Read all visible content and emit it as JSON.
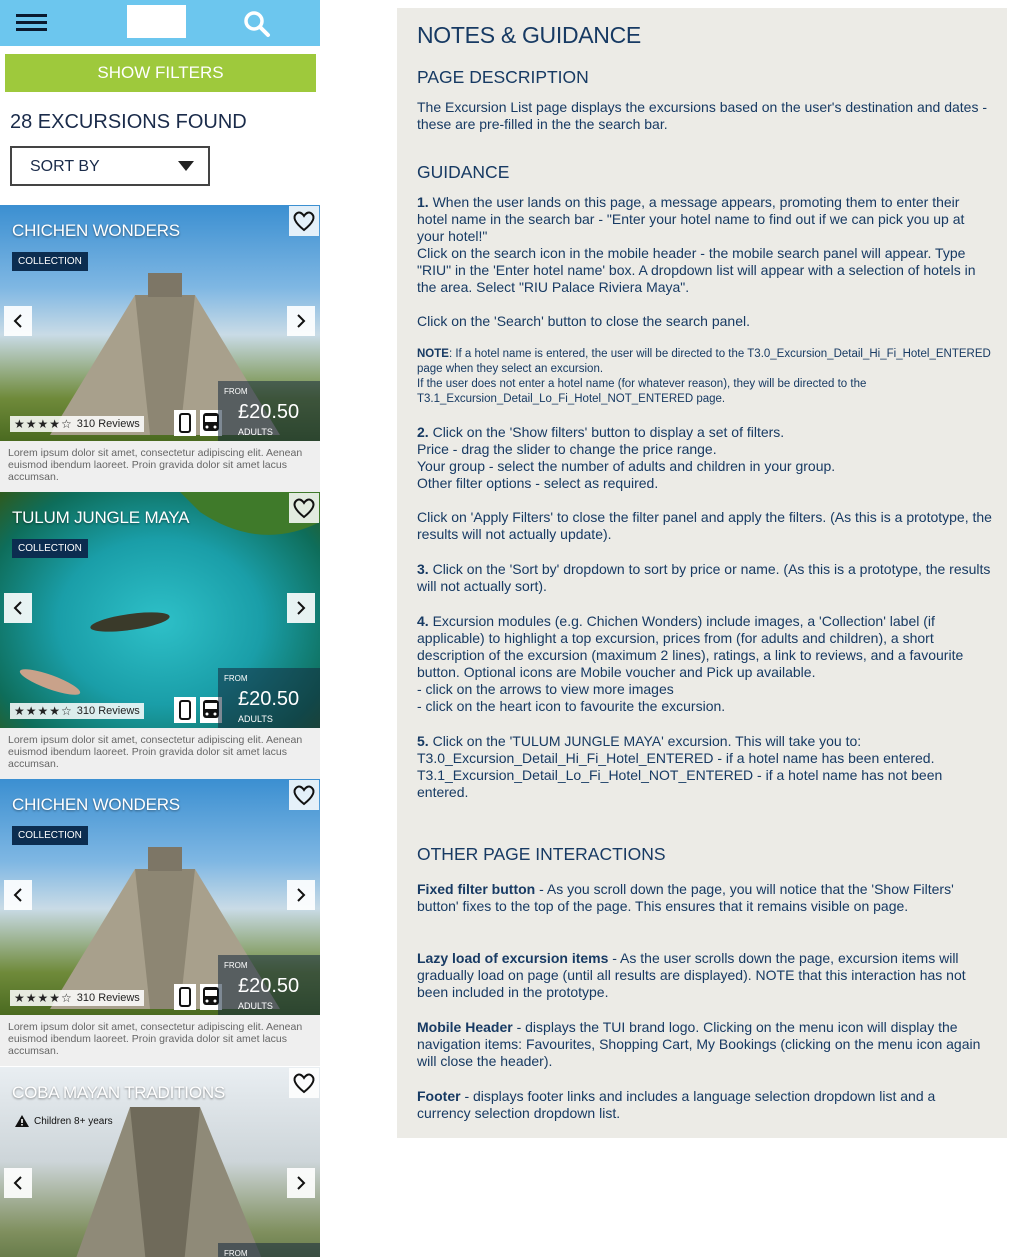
{
  "mobile": {
    "filters_label": "SHOW FILTERS",
    "results_count_text": "28 EXCURSIONS FOUND",
    "sort_label": "SORT BY",
    "cards": [
      {
        "title": "CHICHEN WONDERS",
        "badge": "COLLECTION",
        "rating_text": "310 Reviews",
        "from": "FROM",
        "price": "£20.50",
        "unit": "ADULTS",
        "description": "Lorem ipsum dolor sit amet, consectetur adipiscing elit. Aenean euismod ibendum laoreet. Proin gravida dolor sit amet lacus accumsan."
      },
      {
        "title": "TULUM JUNGLE MAYA",
        "badge": "COLLECTION",
        "rating_text": "310 Reviews",
        "from": "FROM",
        "price": "£20.50",
        "unit": "ADULTS",
        "description": "Lorem ipsum dolor sit amet, consectetur adipiscing elit. Aenean euismod ibendum laoreet. Proin gravida dolor sit amet lacus accumsan."
      },
      {
        "title": "CHICHEN WONDERS",
        "badge": "COLLECTION",
        "rating_text": "310 Reviews",
        "from": "FROM",
        "price": "£20.50",
        "unit": "ADULTS",
        "description": "Lorem ipsum dolor sit amet, consectetur adipiscing elit. Aenean euismod ibendum laoreet. Proin gravida dolor sit amet lacus accumsan."
      },
      {
        "title": "COBA MAYAN TRADITIONS",
        "warning": "Children 8+ years",
        "from": "FROM"
      }
    ],
    "stars": "★★★★☆",
    "colors": {
      "header": "#6cc6ee",
      "filters": "#9ec93c",
      "badge": "#0c2d50"
    }
  },
  "notes": {
    "title": "NOTES & GUIDANCE",
    "page_description_heading": "PAGE DESCRIPTION",
    "page_description": "The Excursion List page displays the excursions based on the user's destination and dates - these are pre-filled in the the search bar.",
    "guidance_heading": "GUIDANCE",
    "g1_num": "1.",
    "g1_text": "When the user lands on this page, a message appears, promoting them to enter their hotel name in the search bar - \"Enter your hotel name to find out if we can pick you up at your hotel!\"",
    "g1_text2": "Click on the search icon in the mobile header - the mobile search panel will appear. Type \"RIU\" in the 'Enter hotel name' box. A dropdown list will appear with a selection of hotels in the area. Select \"RIU Palace Riviera Maya\".",
    "g1_text3": "Click on the 'Search' button to close the search panel.",
    "note_label": "NOTE",
    "note_text": ": If a hotel name is entered, the user will be directed to the T3.0_Excursion_Detail_Hi_Fi_Hotel_ENTERED page when they select an excursion.",
    "note_text2": "If the user does not enter a hotel name (for whatever reason), they will be directed to the T3.1_Excursion_Detail_Lo_Fi_Hotel_NOT_ENTERED page.",
    "g2_num": "2.",
    "g2_text": "Click on the 'Show filters' button to display a set of filters.",
    "g2_line2": "Price - drag the slider to change the price range.",
    "g2_line3": "Your group - select the number of adults and children in your group.",
    "g2_line4": "Other filter options - select as required.",
    "g2_text5": "Click on 'Apply Filters' to close the filter panel and apply the filters. (As this is a prototype, the results will not actually update).",
    "g3_num": "3.",
    "g3_text": "Click on the 'Sort by' dropdown to sort by price or name. (As this is a prototype, the results will not actually sort).",
    "g4_num": "4.",
    "g4_text": "Excursion modules (e.g. Chichen Wonders) include images, a 'Collection' label (if applicable) to highlight a top excursion, prices from (for adults and children), a short description of the excursion (maximum 2 lines), ratings, a link to reviews, and a favourite button. Optional icons are Mobile voucher and Pick up available.",
    "g4_line2": "- click on the arrows to view more images",
    "g4_line3": "- click on the heart icon to favourite the excursion.",
    "g5_num": "5.",
    "g5_text": "Click on the 'TULUM JUNGLE MAYA' excursion. This will take you to:",
    "g5_line2": "T3.0_Excursion_Detail_Hi_Fi_Hotel_ENTERED  - if a hotel name has been entered.",
    "g5_line3": "T3.1_Excursion_Detail_Lo_Fi_Hotel_NOT_ENTERED - if a hotel name has not been entered.",
    "other_heading": "OTHER PAGE INTERACTIONS",
    "o1_label": "Fixed filter button",
    "o1_text": " - As you scroll down the page, you will notice that the 'Show Filters' button' fixes to the top of the page. This ensures that it remains visible on page.",
    "o2_label": "Lazy load of excursion items",
    "o2_text": " - As the user scrolls down the page, excursion items will gradually load on page (until all results are displayed). NOTE that this interaction has not been included in the prototype.",
    "o3_label": "Mobile Header",
    "o3_text": " - displays the TUI brand logo. Clicking on the menu icon will display the navigation items: Favourites, Shopping Cart, My Bookings (clicking on the menu icon again will close the header).",
    "o4_label": "Footer",
    "o4_text": " - displays footer links and includes a language selection dropdown list and a currency selection dropdown list."
  }
}
